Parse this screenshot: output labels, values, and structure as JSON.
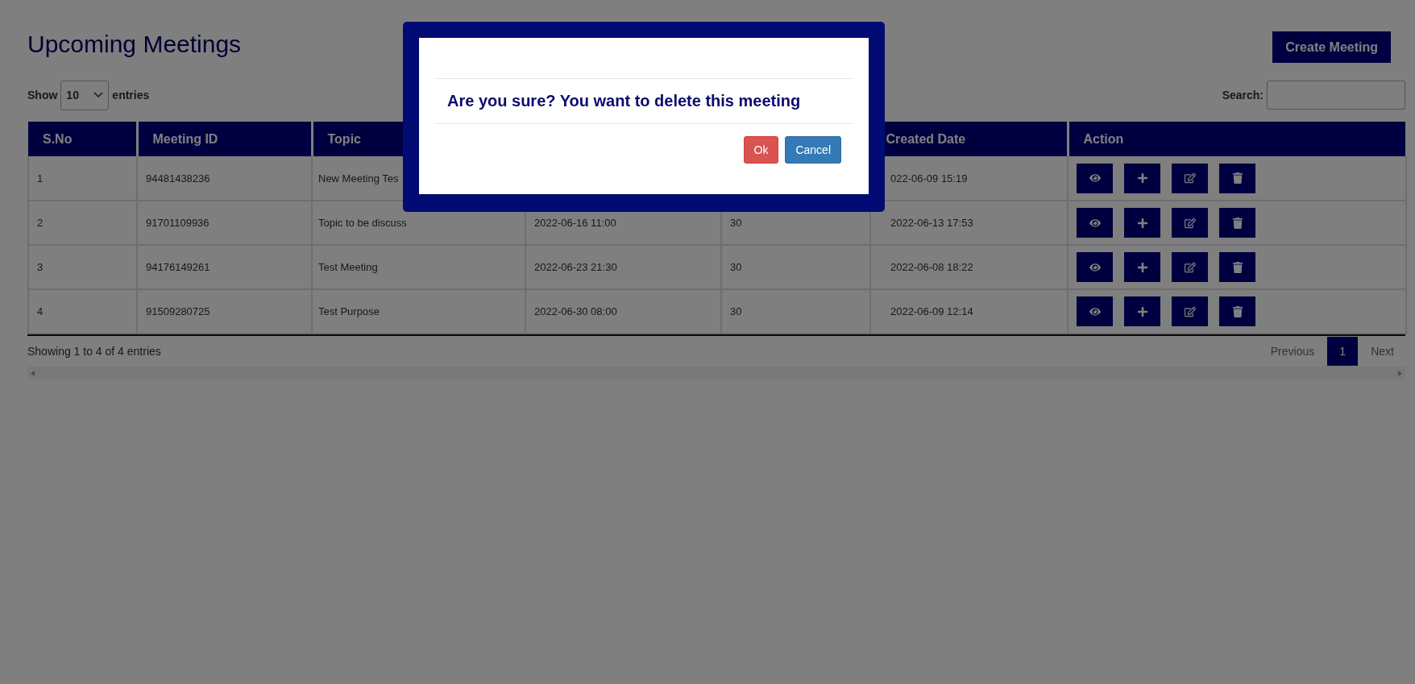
{
  "page": {
    "title": "Upcoming Meetings",
    "create_button": "Create Meeting"
  },
  "length_control": {
    "prefix": "Show",
    "value": "10",
    "suffix": "entries"
  },
  "search": {
    "label": "Search:"
  },
  "table": {
    "columns": [
      {
        "label": "S.No"
      },
      {
        "label": "Meeting ID"
      },
      {
        "label": "Topic"
      },
      {},
      {},
      {
        "label": "Created Date"
      },
      {
        "label": "Action"
      }
    ],
    "rows": [
      {
        "cells": [
          "1",
          "94481438236",
          "New Meeting Tes",
          null,
          null,
          "022-06-09 15:19"
        ]
      },
      {
        "cells": [
          "2",
          "91701109936",
          "Topic to be discuss",
          "2022-06-16 11:00",
          "30",
          "2022-06-13 17:53"
        ]
      },
      {
        "cells": [
          "3",
          "94176149261",
          "Test Meeting",
          "2022-06-23 21:30",
          "30",
          "2022-06-08 18:22"
        ]
      },
      {
        "cells": [
          "4",
          "91509280725",
          "Test Purpose",
          "2022-06-30 08:00",
          "30",
          "2022-06-09 12:14"
        ]
      }
    ]
  },
  "info": "Showing 1 to 4 of 4 entries",
  "pagination": {
    "previous": "Previous",
    "pages": [
      {
        "label": "1",
        "selected": true
      }
    ],
    "next": "Next"
  },
  "dialog": {
    "message": "Are you sure? You want to delete this meeting",
    "buttons": [
      {
        "label": "Ok",
        "kind": "danger"
      },
      {
        "label": "Cancel",
        "kind": "primary"
      }
    ]
  }
}
